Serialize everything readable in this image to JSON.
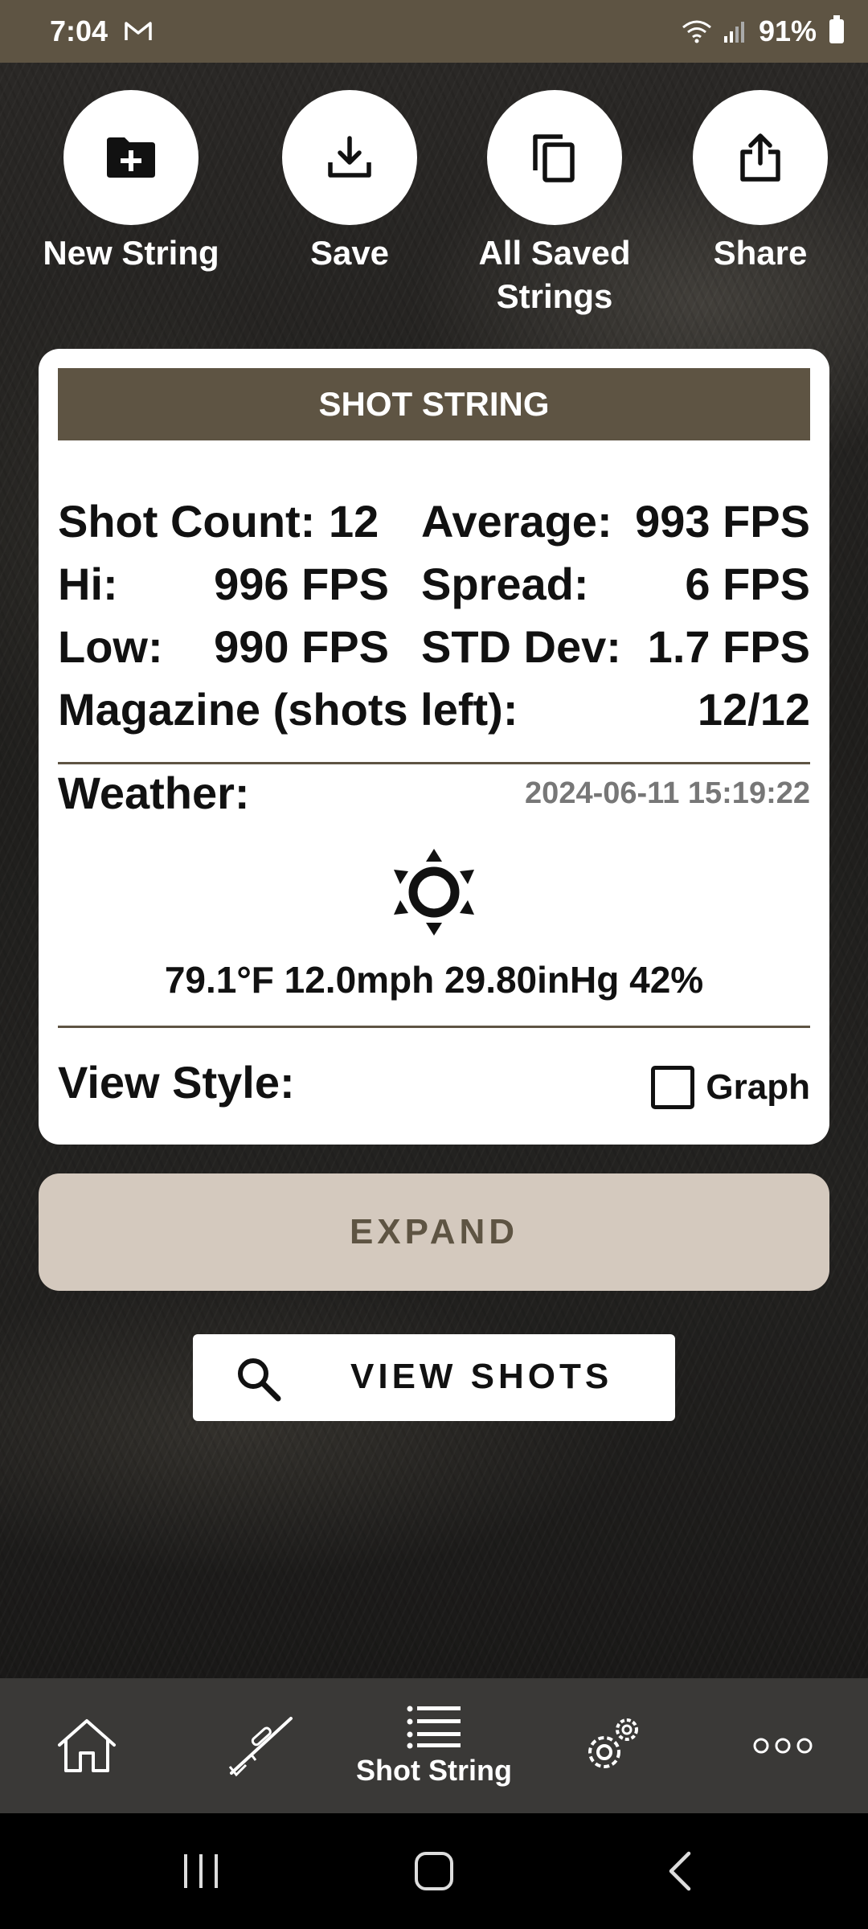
{
  "status_bar": {
    "time": "7:04",
    "battery": "91%",
    "icons": [
      "mail-icon",
      "wifi-icon",
      "signal-icon",
      "battery-icon"
    ]
  },
  "actions": [
    {
      "label": "New String",
      "icon": "new-folder-icon"
    },
    {
      "label": "Save",
      "icon": "download-icon"
    },
    {
      "label": "All Saved Strings",
      "icon": "copy-icon"
    },
    {
      "label": "Share",
      "icon": "share-icon"
    }
  ],
  "card": {
    "header": "SHOT STRING",
    "shot_count_label": "Shot Count:",
    "shot_count_value": "12",
    "average_label": "Average:",
    "average_value": "993 FPS",
    "hi_label": "Hi:",
    "hi_value": "996 FPS",
    "spread_label": "Spread:",
    "spread_value": "6 FPS",
    "low_label": "Low:",
    "low_value": "990 FPS",
    "std_label": "STD Dev:",
    "std_value": "1.7 FPS",
    "magazine_label": "Magazine (shots left):",
    "magazine_value": "12/12",
    "weather_label": "Weather:",
    "weather_time": "2024-06-11 15:19:22",
    "weather_icon": "sun-icon",
    "weather_values": "79.1°F 12.0mph 29.80inHg 42%",
    "view_style_label": "View Style:",
    "graph_label": "Graph",
    "graph_checked": false
  },
  "expand_label": "EXPAND",
  "view_shots_label": "VIEW SHOTS",
  "bottom_nav": {
    "items": [
      {
        "icon": "home-icon",
        "label": ""
      },
      {
        "icon": "rifle-icon",
        "label": ""
      },
      {
        "icon": "list-icon",
        "label": "Shot String"
      },
      {
        "icon": "gears-icon",
        "label": ""
      },
      {
        "icon": "more-icon",
        "label": ""
      }
    ]
  },
  "colors": {
    "brand": "#5e5443",
    "expand_bg": "#d4c9be",
    "nav_bg": "#3a3937"
  }
}
